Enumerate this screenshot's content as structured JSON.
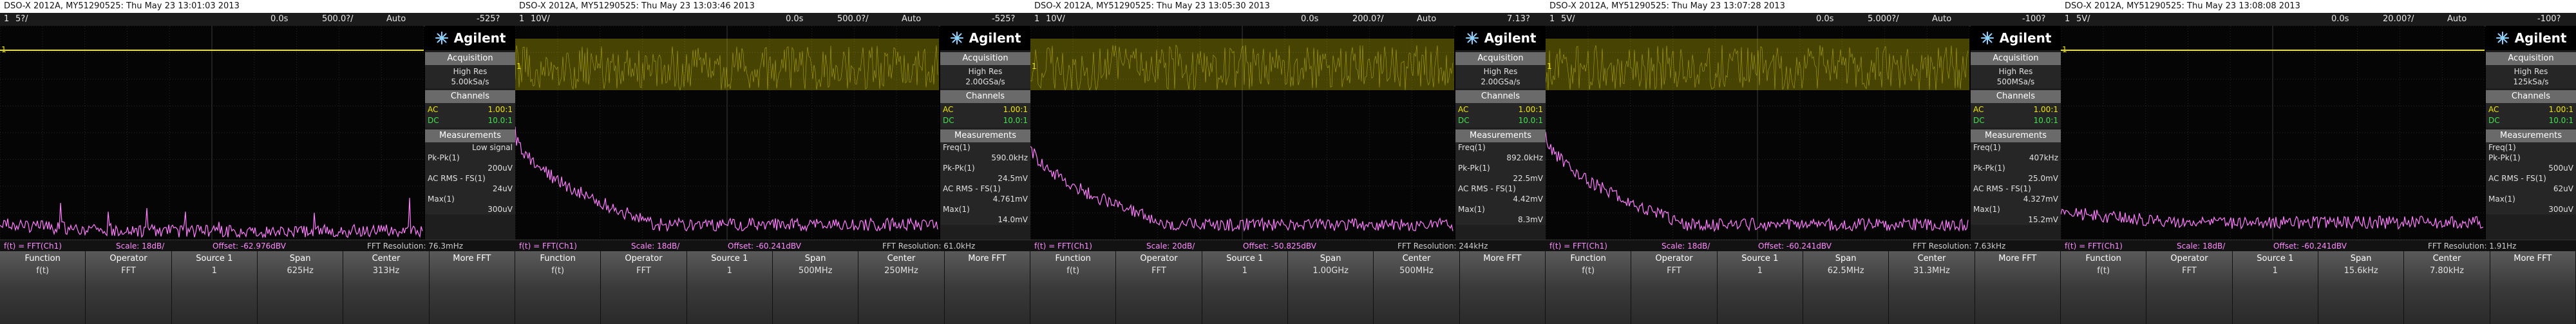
{
  "colors": {
    "ch1": "#f0e600",
    "fft": "#ff7cff",
    "ch2": "#3ee64a",
    "brand": "#ffffff"
  },
  "panels": [
    {
      "caption": "DSO-X 2012A, MY51290525: Thu May 23 13:01:03 2013",
      "status": {
        "chan": "1",
        "vdiv": "5?/",
        "delay": "0.0s",
        "tdiv": "500.0?/",
        "mode": "Auto",
        "trig": "-525?"
      },
      "acquisition": {
        "mode": "High Res",
        "rate": "5.00kSa/s"
      },
      "channels": [
        {
          "name": "AC",
          "val": "1.00:1"
        },
        {
          "name": "DC",
          "val": "10.0:1"
        }
      ],
      "measurements": [
        {
          "name": "",
          "value": "Low signal"
        },
        {
          "name": "Pk-Pk(1)",
          "value": "200uV"
        },
        {
          "name": "AC RMS - FS(1)",
          "value": "24uV"
        },
        {
          "name": "Max(1)",
          "value": "300uV"
        }
      ],
      "fft": {
        "ch": "f(t) = FFT(Ch1)",
        "scale": "Scale: 18dB/",
        "offset": "Offset: -62.976dBV",
        "res": "FFT Resolution: 76.3mHz"
      },
      "softkeys": [
        {
          "label": "Function",
          "value": "f(t)"
        },
        {
          "label": "Operator",
          "value": "FFT"
        },
        {
          "label": "Source 1",
          "value": "1"
        },
        {
          "label": "Span",
          "value": "625Hz"
        },
        {
          "label": "Center",
          "value": "313Hz"
        },
        {
          "label": "More FFT",
          "value": ""
        }
      ],
      "trace": {
        "noise": 0.62,
        "wide": false
      },
      "spectrum": {
        "start": 0.92,
        "end": 0.96,
        "spikes": true
      }
    },
    {
      "caption": "DSO-X 2012A, MY51290525: Thu May 23 13:03:46 2013",
      "status": {
        "chan": "1",
        "vdiv": "10V/",
        "delay": "0.0s",
        "tdiv": "500.0?/",
        "mode": "Auto",
        "trig": "-525?"
      },
      "acquisition": {
        "mode": "High Res",
        "rate": "2.00GSa/s"
      },
      "channels": [
        {
          "name": "AC",
          "val": "1.00:1"
        },
        {
          "name": "DC",
          "val": "10.0:1"
        }
      ],
      "measurements": [
        {
          "name": "Freq(1)",
          "value": "590.0kHz"
        },
        {
          "name": "Pk-Pk(1)",
          "value": "24.5mV"
        },
        {
          "name": "AC RMS - FS(1)",
          "value": "4.761mV"
        },
        {
          "name": "Max(1)",
          "value": "14.0mV"
        }
      ],
      "fft": {
        "ch": "f(t) = FFT(Ch1)",
        "scale": "Scale: 18dB/",
        "offset": "Offset: -60.241dBV",
        "res": "FFT Resolution: 61.0kHz"
      },
      "softkeys": [
        {
          "label": "Function",
          "value": "f(t)"
        },
        {
          "label": "Operator",
          "value": "FFT"
        },
        {
          "label": "Source 1",
          "value": "1"
        },
        {
          "label": "Span",
          "value": "500MHz"
        },
        {
          "label": "Center",
          "value": "250MHz"
        },
        {
          "label": "More FFT",
          "value": ""
        }
      ],
      "trace": {
        "noise": 0.62,
        "wide": true
      },
      "spectrum": {
        "start": 0.5,
        "end": 0.93,
        "spikes": false
      }
    },
    {
      "caption": "DSO-X 2012A, MY51290525: Thu May 23 13:05:30 2013",
      "status": {
        "chan": "1",
        "vdiv": "10V/",
        "delay": "0.0s",
        "tdiv": "200.0?/",
        "mode": "Auto",
        "trig": "7.13?"
      },
      "acquisition": {
        "mode": "High Res",
        "rate": "2.00GSa/s"
      },
      "channels": [
        {
          "name": "AC",
          "val": "1.00:1"
        },
        {
          "name": "DC",
          "val": "10.0:1"
        }
      ],
      "measurements": [
        {
          "name": "Freq(1)",
          "value": "892.0kHz"
        },
        {
          "name": "Pk-Pk(1)",
          "value": "22.5mV"
        },
        {
          "name": "AC RMS - FS(1)",
          "value": "4.42mV"
        },
        {
          "name": "Max(1)",
          "value": "8.3mV"
        }
      ],
      "fft": {
        "ch": "f(t) = FFT(Ch1)",
        "scale": "Scale: 20dB/",
        "offset": "Offset: -50.825dBV",
        "res": "FFT Resolution: 244kHz"
      },
      "softkeys": [
        {
          "label": "Function",
          "value": "f(t)"
        },
        {
          "label": "Operator",
          "value": "FFT"
        },
        {
          "label": "Source 1",
          "value": "1"
        },
        {
          "label": "Span",
          "value": "1.00GHz"
        },
        {
          "label": "Center",
          "value": "500MHz"
        },
        {
          "label": "More FFT",
          "value": ""
        }
      ],
      "trace": {
        "noise": 0.62,
        "wide": true
      },
      "spectrum": {
        "start": 0.55,
        "end": 0.93,
        "spikes": false
      }
    },
    {
      "caption": "DSO-X 2012A, MY51290525: Thu May 23 13:07:28 2013",
      "status": {
        "chan": "1",
        "vdiv": "5V/",
        "delay": "0.0s",
        "tdiv": "5.000?/",
        "mode": "Auto",
        "trig": "-100?"
      },
      "acquisition": {
        "mode": "High Res",
        "rate": "500MSa/s"
      },
      "channels": [
        {
          "name": "AC",
          "val": "1.00:1"
        },
        {
          "name": "DC",
          "val": "10.0:1"
        }
      ],
      "measurements": [
        {
          "name": "Freq(1)",
          "value": "407kHz"
        },
        {
          "name": "Pk-Pk(1)",
          "value": "25.0mV"
        },
        {
          "name": "AC RMS - FS(1)",
          "value": "4.327mV"
        },
        {
          "name": "Max(1)",
          "value": "15.2mV"
        }
      ],
      "fft": {
        "ch": "f(t) = FFT(Ch1)",
        "scale": "Scale: 18dB/",
        "offset": "Offset: -60.241dBV",
        "res": "FFT Resolution: 7.63kHz"
      },
      "softkeys": [
        {
          "label": "Function",
          "value": "f(t)"
        },
        {
          "label": "Operator",
          "value": "FFT"
        },
        {
          "label": "Source 1",
          "value": "1"
        },
        {
          "label": "Span",
          "value": "62.5MHz"
        },
        {
          "label": "Center",
          "value": "31.3MHz"
        },
        {
          "label": "More FFT",
          "value": ""
        }
      ],
      "trace": {
        "noise": 0.62,
        "wide": true
      },
      "spectrum": {
        "start": 0.5,
        "end": 0.93,
        "spikes": false
      }
    },
    {
      "caption": "DSO-X 2012A, MY51290525: Thu May 23 13:08:08 2013",
      "status": {
        "chan": "1",
        "vdiv": "5V/",
        "delay": "0.0s",
        "tdiv": "20.00?/",
        "mode": "Auto",
        "trig": "-100?"
      },
      "acquisition": {
        "mode": "High Res",
        "rate": "125kSa/s"
      },
      "channels": [
        {
          "name": "AC",
          "val": "1.00:1"
        },
        {
          "name": "DC",
          "val": "10.0:1"
        }
      ],
      "measurements": [
        {
          "name": "Freq(1)",
          "value": ""
        },
        {
          "name": "Pk-Pk(1)",
          "value": "500uV"
        },
        {
          "name": "AC RMS - FS(1)",
          "value": "62uV"
        },
        {
          "name": "Max(1)",
          "value": "300uV"
        }
      ],
      "fft": {
        "ch": "f(t) = FFT(Ch1)",
        "scale": "Scale: 18dB/",
        "offset": "Offset: -60.241dBV",
        "res": "FFT Resolution: 1.91Hz"
      },
      "softkeys": [
        {
          "label": "Function",
          "value": "f(t)"
        },
        {
          "label": "Operator",
          "value": "FFT"
        },
        {
          "label": "Source 1",
          "value": "1"
        },
        {
          "label": "Span",
          "value": "15.6kHz"
        },
        {
          "label": "Center",
          "value": "7.80kHz"
        },
        {
          "label": "More FFT",
          "value": ""
        }
      ],
      "trace": {
        "noise": 0.62,
        "wide": false
      },
      "spectrum": {
        "start": 0.86,
        "end": 0.92,
        "spikes": false
      }
    }
  ],
  "labels": {
    "brand": "Agilent",
    "acquisition": "Acquisition",
    "channels": "Channels",
    "measurements": "Measurements"
  }
}
